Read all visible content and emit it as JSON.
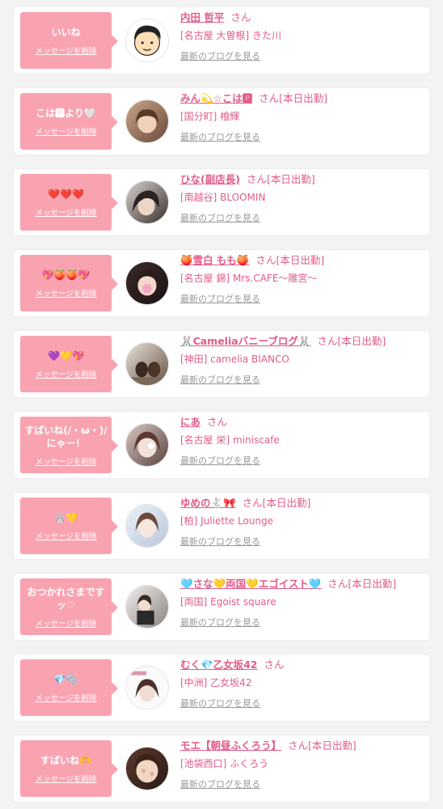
{
  "follow_list": {
    "delete_label": "メッセージを削除",
    "san_label": "さん",
    "blog_link_label": "最新のブログを見る",
    "items": [
      {
        "message": "いいね",
        "name": "内田 哲平",
        "status": "",
        "shop": "[名古屋 大曽根] きた川",
        "avatar": "cartoon-man"
      },
      {
        "message": "こは🅿より🤍",
        "name": "みん💫☆こは🅿",
        "status": "[本日出勤]",
        "shop": "[国分町] 檜輝",
        "avatar": "photo"
      },
      {
        "message": "❤️❤️❤️",
        "name": "ひな(副店長)",
        "status": "[本日出勤]",
        "shop": "[南越谷] BLOOMIN",
        "avatar": "photo"
      },
      {
        "message": "💖🍑🍑💖",
        "name": "🍑雪白 もも🍑",
        "status": "[本日出勤]",
        "shop": "[名古屋 錦] Mrs.CAFE〜雕宮〜",
        "avatar": "photo"
      },
      {
        "message": "💜💛💖",
        "name": "🐰Cameliaバニーブログ🐰",
        "status": "[本日出勤]",
        "shop": "[神田] camelia BIANCO",
        "avatar": "photo"
      },
      {
        "message": "すばいね(/・ω・)/にゃー！",
        "name": "にあ",
        "status": "",
        "shop": "[名古屋 栄] miniscafe",
        "avatar": "photo"
      },
      {
        "message": "🐰💛",
        "name": "ゆめの🐇🎀",
        "status": "[本日出勤]",
        "shop": "[柏] Juliette Lounge",
        "avatar": "photo"
      },
      {
        "message": "おつかれさまですッ♡",
        "name": "🩵さな💛両国💛エゴイスト🩵",
        "status": "[本日出勤]",
        "shop": "[両国] Egoist square",
        "avatar": "photo"
      },
      {
        "message": "💎🫧",
        "name": "むく💎乙女坂42",
        "status": "",
        "shop": "[中洲] 乙女坂42",
        "avatar": "photo"
      },
      {
        "message": "すばいね🫶",
        "name": "モエ【朝昼ふくろう】",
        "status": "[本日出勤]",
        "shop": "[池袋西口] ふくろう",
        "avatar": "photo"
      }
    ]
  },
  "colors": {
    "accent": "#e25c8a",
    "bubble": "#f9a3b1",
    "link_gray": "#999999",
    "background": "#f3f3f3"
  }
}
